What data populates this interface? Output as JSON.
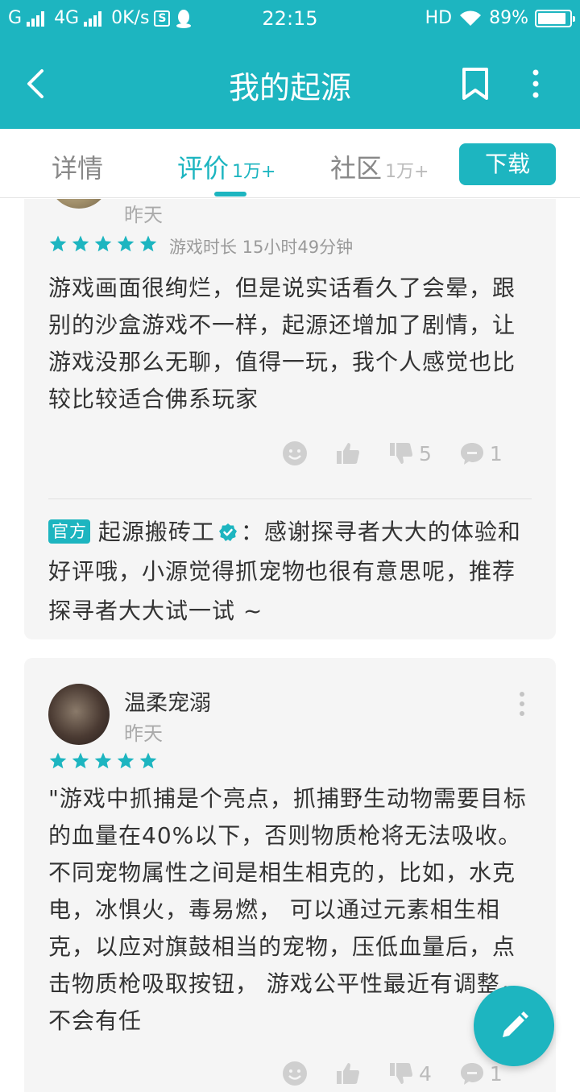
{
  "status_bar": {
    "carrier1": "G",
    "carrier2": "4G",
    "speed": "0K/s",
    "app_icon": "S",
    "time": "22:15",
    "hd": "HD",
    "battery": "89%",
    "battery_level": 0.89
  },
  "app_bar": {
    "title": "我的起源"
  },
  "tabs": [
    {
      "label": "详情",
      "count": ""
    },
    {
      "label": "评价",
      "count": "1万+"
    },
    {
      "label": "社区",
      "count": "1万+"
    }
  ],
  "download_button": "下载",
  "reviews": [
    {
      "date": "昨天",
      "rating": 5,
      "playtime": "游戏时长 15小时49分钟",
      "text": "游戏画面很绚烂，但是说实话看久了会晕，跟别的沙盒游戏不一样，起源还增加了剧情，让游戏没那么无聊，值得一玩，我个人感觉也比较比较适合佛系玩家",
      "dislikes": "5",
      "comments": "1",
      "reply": {
        "badge": "官方",
        "author": "起源搬砖工",
        "text": "：感谢探寻者大大的体验和好评哦，小源觉得抓宠物也很有意思呢，推荐探寻者大大试一试 ~"
      }
    },
    {
      "username": "温柔宠溺",
      "date": "昨天",
      "rating": 5,
      "text": "\"游戏中抓捕是个亮点，抓捕野生动物需要目标的血量在40%以下，否则物质枪将无法吸收。 不同宠物属性之间是相生相克的，比如，水克电，冰惧火，毒易燃， 可以通过元素相生相克，以应对旗鼓相当的宠物，压低血量后，点击物质枪吸取按钮， 游戏公平性最近有调整，不会有任",
      "dislikes": "4",
      "comments": "1"
    }
  ],
  "colors": {
    "accent": "#1db5c0",
    "card_bg": "#f5f5f5",
    "icon_gray": "#c4c4c4"
  }
}
